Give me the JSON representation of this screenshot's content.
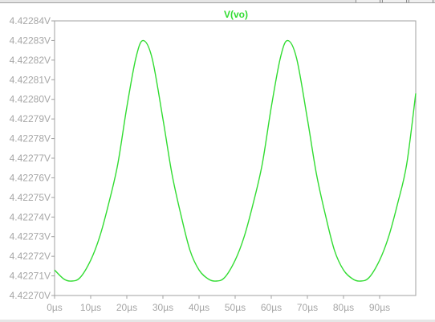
{
  "colors": {
    "background": "#e6e6e6",
    "plot_background": "#ffffff",
    "axis": "#a0a0a0",
    "tick_text": "#a6a6a6",
    "trace": "#32dc32"
  },
  "chart_data": {
    "type": "line",
    "title": "V(vo)",
    "xlabel": "",
    "ylabel": "",
    "xlim": [
      0,
      100
    ],
    "ylim": [
      4.4227,
      4.42284
    ],
    "x_unit": "µs",
    "x_tick_labels": [
      "0µs",
      "10µs",
      "20µs",
      "30µs",
      "40µs",
      "50µs",
      "60µs",
      "70µs",
      "80µs",
      "90µs"
    ],
    "y_tick_labels": [
      "4.42270V",
      "4.42271V",
      "4.42272V",
      "4.42273V",
      "4.42274V",
      "4.42275V",
      "4.42276V",
      "4.42277V",
      "4.42278V",
      "4.42279V",
      "4.42280V",
      "4.42281V",
      "4.42282V",
      "4.42283V",
      "4.42284V"
    ],
    "grid": false,
    "series": [
      {
        "name": "V(vo)",
        "color": "#32dc32",
        "x": [
          0,
          2.5,
          4.5,
          7,
          10,
          12.5,
          15,
          17.5,
          20,
          22.5,
          24.5,
          27,
          30,
          32.5,
          35,
          37.5,
          40,
          42.5,
          44.5,
          47,
          50,
          52.5,
          55,
          57.5,
          60,
          62.5,
          64.5,
          67,
          70,
          72.5,
          75,
          77.5,
          80,
          82.5,
          84.5,
          87,
          90,
          92.5,
          95,
          97.5,
          100
        ],
        "y": [
          4.422713,
          4.4227085,
          4.42270735,
          4.422709,
          4.422718,
          4.42273,
          4.422747,
          4.422767,
          4.422796,
          4.422821,
          4.42283,
          4.422821,
          4.42279,
          4.422762,
          4.422741,
          4.422723,
          4.422713,
          4.4227085,
          4.42270735,
          4.422709,
          4.422718,
          4.42273,
          4.422747,
          4.422767,
          4.422796,
          4.422821,
          4.42283,
          4.422821,
          4.42279,
          4.422762,
          4.422741,
          4.422723,
          4.422713,
          4.4227085,
          4.42270735,
          4.422709,
          4.422718,
          4.42273,
          4.422747,
          4.422767,
          4.422803
        ]
      }
    ]
  }
}
